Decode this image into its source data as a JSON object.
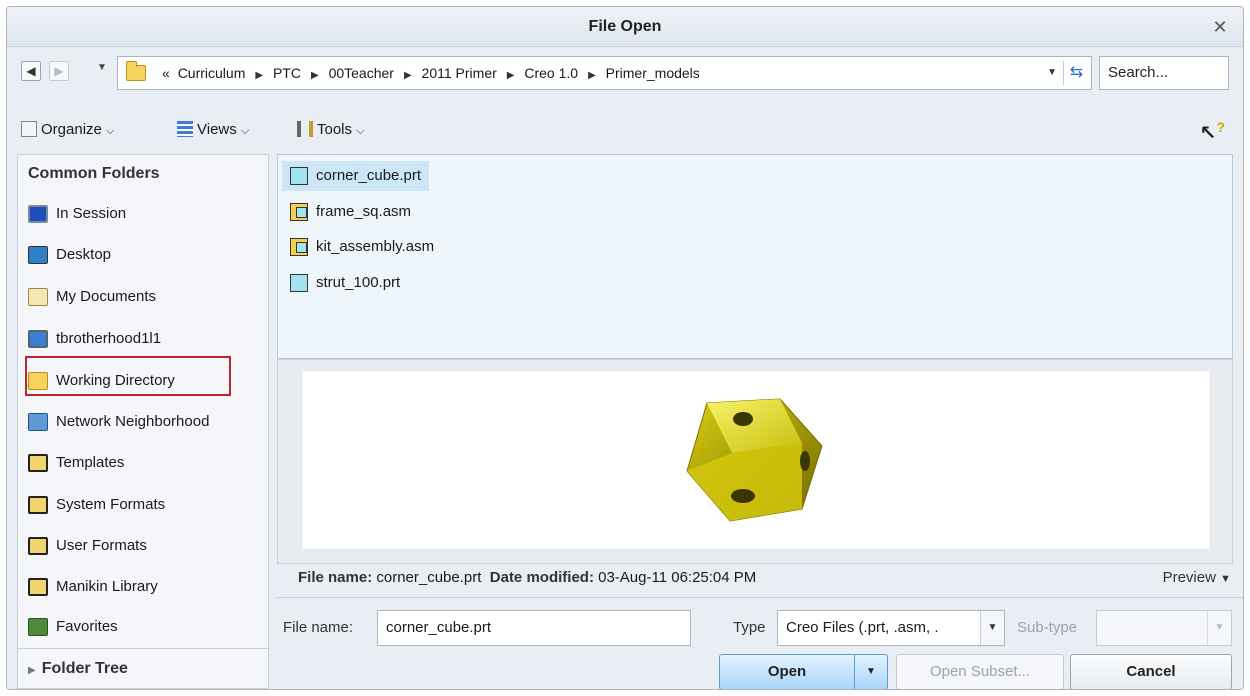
{
  "dialog": {
    "title": "File Open"
  },
  "address": {
    "crumbs": [
      "«",
      "Curriculum",
      "PTC",
      "00Teacher",
      "2011 Primer",
      "Creo 1.0",
      "Primer_models"
    ],
    "search_placeholder": "Search..."
  },
  "toolbar": {
    "organize": "Organize",
    "views": "Views",
    "tools": "Tools"
  },
  "sidebar": {
    "heading": "Common Folders",
    "items": [
      {
        "label": "In Session",
        "icon": "session-icon"
      },
      {
        "label": "Desktop",
        "icon": "desktop-icon"
      },
      {
        "label": "My Documents",
        "icon": "my-documents-icon"
      },
      {
        "label": "tbrotherhood1l1",
        "icon": "computer-icon"
      },
      {
        "label": "Working Directory",
        "icon": "working-directory-icon"
      },
      {
        "label": "Network Neighborhood",
        "icon": "network-icon"
      },
      {
        "label": "Templates",
        "icon": "folder-icon"
      },
      {
        "label": "System Formats",
        "icon": "folder-icon"
      },
      {
        "label": "User Formats",
        "icon": "folder-icon"
      },
      {
        "label": "Manikin Library",
        "icon": "folder-icon"
      },
      {
        "label": "Favorites",
        "icon": "favorites-icon"
      }
    ],
    "footer": "Folder Tree"
  },
  "files": [
    {
      "name": "corner_cube.prt",
      "kind": "part",
      "selected": true
    },
    {
      "name": "frame_sq.asm",
      "kind": "assembly"
    },
    {
      "name": "kit_assembly.asm",
      "kind": "assembly"
    },
    {
      "name": "strut_100.prt",
      "kind": "part"
    }
  ],
  "info": {
    "file_name_label": "File name:",
    "file_name_value": "corner_cube.prt",
    "date_label": "Date modified:",
    "date_value": "03-Aug-11 06:25:04 PM",
    "preview_label": "Preview"
  },
  "form": {
    "file_name_label": "File name:",
    "file_name_value": "corner_cube.prt",
    "type_label": "Type",
    "type_value": "Creo Files (.prt, .asm, .",
    "subtype_label": "Sub-type"
  },
  "buttons": {
    "open": "Open",
    "open_subset": "Open Subset...",
    "cancel": "Cancel"
  }
}
